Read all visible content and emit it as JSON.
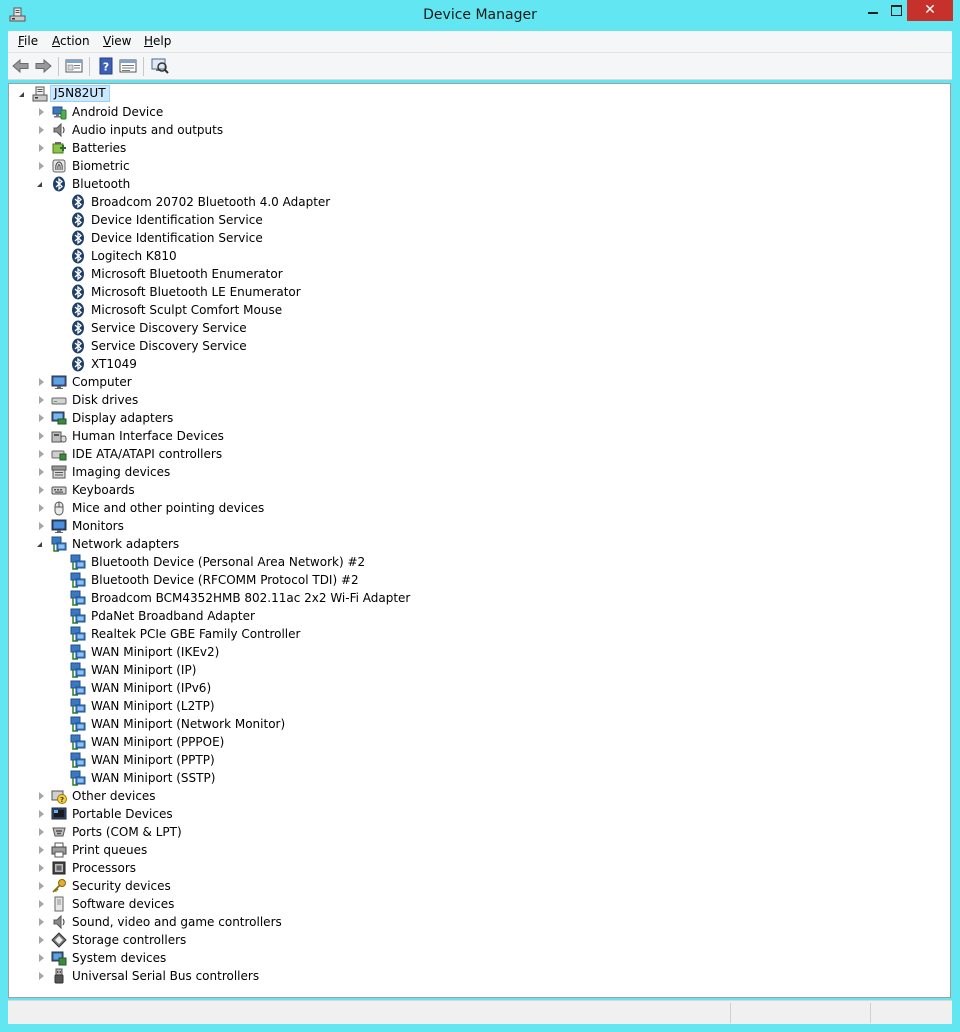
{
  "window": {
    "title": "Device Manager"
  },
  "menu": [
    "File",
    "Action",
    "View",
    "Help"
  ],
  "colors": {
    "titlebar": "#62e6f1",
    "close": "#c7312b",
    "selection": "#cce8ff"
  },
  "tree": {
    "root": "J5N82UT",
    "categories": [
      {
        "label": "Android Device",
        "icon": "android-icon",
        "expanded": false,
        "children": []
      },
      {
        "label": "Audio inputs and outputs",
        "icon": "speaker-icon",
        "expanded": false,
        "children": []
      },
      {
        "label": "Batteries",
        "icon": "battery-icon",
        "expanded": false,
        "children": []
      },
      {
        "label": "Biometric",
        "icon": "fingerprint-icon",
        "expanded": false,
        "children": []
      },
      {
        "label": "Bluetooth",
        "icon": "bluetooth-icon",
        "expanded": true,
        "children": [
          "Broadcom 20702 Bluetooth 4.0 Adapter",
          "Device Identification Service",
          "Device Identification Service",
          "Logitech K810",
          "Microsoft Bluetooth Enumerator",
          "Microsoft Bluetooth LE Enumerator",
          "Microsoft Sculpt Comfort Mouse",
          "Service Discovery Service",
          "Service Discovery Service",
          "XT1049"
        ]
      },
      {
        "label": "Computer",
        "icon": "computer-icon",
        "expanded": false,
        "children": []
      },
      {
        "label": "Disk drives",
        "icon": "disk-drive-icon",
        "expanded": false,
        "children": []
      },
      {
        "label": "Display adapters",
        "icon": "display-adapter-icon",
        "expanded": false,
        "children": []
      },
      {
        "label": "Human Interface Devices",
        "icon": "hid-icon",
        "expanded": false,
        "children": []
      },
      {
        "label": "IDE ATA/ATAPI controllers",
        "icon": "ide-controller-icon",
        "expanded": false,
        "children": []
      },
      {
        "label": "Imaging devices",
        "icon": "camera-icon",
        "expanded": false,
        "children": []
      },
      {
        "label": "Keyboards",
        "icon": "keyboard-icon",
        "expanded": false,
        "children": []
      },
      {
        "label": "Mice and other pointing devices",
        "icon": "mouse-icon",
        "expanded": false,
        "children": []
      },
      {
        "label": "Monitors",
        "icon": "monitor-icon",
        "expanded": false,
        "children": []
      },
      {
        "label": "Network adapters",
        "icon": "network-icon",
        "expanded": true,
        "children": [
          "Bluetooth Device (Personal Area Network) #2",
          "Bluetooth Device (RFCOMM Protocol TDI) #2",
          "Broadcom BCM4352HMB 802.11ac 2x2 Wi-Fi Adapter",
          "PdaNet Broadband Adapter",
          "Realtek PCIe GBE Family Controller",
          "WAN Miniport (IKEv2)",
          "WAN Miniport (IP)",
          "WAN Miniport (IPv6)",
          "WAN Miniport (L2TP)",
          "WAN Miniport (Network Monitor)",
          "WAN Miniport (PPPOE)",
          "WAN Miniport (PPTP)",
          "WAN Miniport (SSTP)"
        ]
      },
      {
        "label": "Other devices",
        "icon": "unknown-device-icon",
        "expanded": false,
        "children": []
      },
      {
        "label": "Portable Devices",
        "icon": "portable-device-icon",
        "expanded": false,
        "children": []
      },
      {
        "label": "Ports (COM & LPT)",
        "icon": "port-icon",
        "expanded": false,
        "children": []
      },
      {
        "label": "Print queues",
        "icon": "printer-icon",
        "expanded": false,
        "children": []
      },
      {
        "label": "Processors",
        "icon": "processor-icon",
        "expanded": false,
        "children": []
      },
      {
        "label": "Security devices",
        "icon": "key-icon",
        "expanded": false,
        "children": []
      },
      {
        "label": "Software devices",
        "icon": "software-device-icon",
        "expanded": false,
        "children": []
      },
      {
        "label": "Sound, video and game controllers",
        "icon": "speaker-icon",
        "expanded": false,
        "children": []
      },
      {
        "label": "Storage controllers",
        "icon": "storage-controller-icon",
        "expanded": false,
        "children": []
      },
      {
        "label": "System devices",
        "icon": "system-device-icon",
        "expanded": false,
        "children": []
      },
      {
        "label": "Universal Serial Bus controllers",
        "icon": "usb-icon",
        "expanded": false,
        "children": []
      }
    ]
  }
}
